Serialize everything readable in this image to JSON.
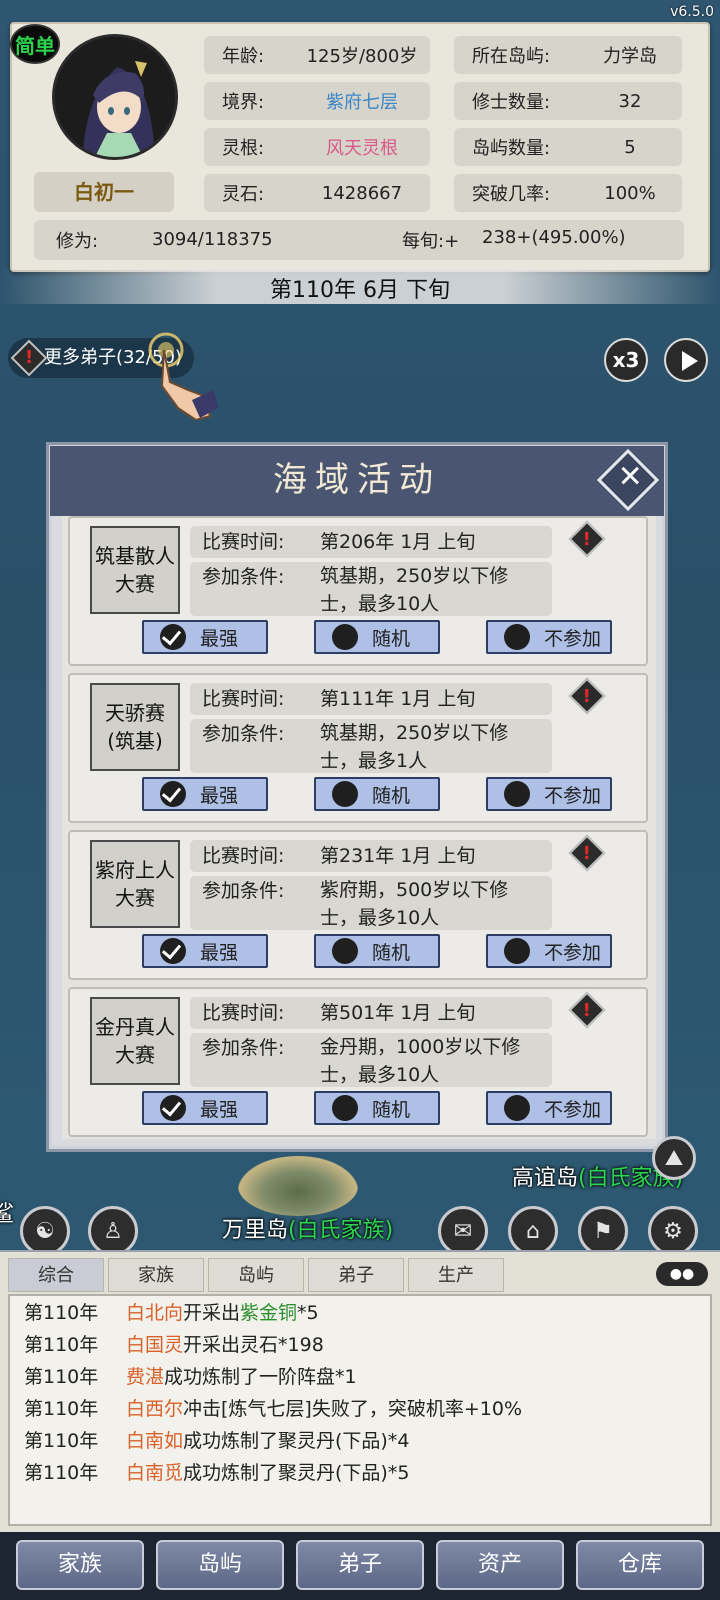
{
  "version": "v6.5.0",
  "difficulty": "简单",
  "player": {
    "name": "白初一",
    "stats_left": [
      {
        "key": "年龄:",
        "value": "125岁/800岁",
        "color": "#222222"
      },
      {
        "key": "境界:",
        "value": "紫府七层",
        "color": "#3a86c8"
      },
      {
        "key": "灵根:",
        "value": "风天灵根",
        "color": "#d95a8a"
      },
      {
        "key": "灵石:",
        "value": "1428667",
        "color": "#222222"
      }
    ],
    "stats_right": [
      {
        "key": "所在岛屿:",
        "value": "力学岛"
      },
      {
        "key": "修士数量:",
        "value": "32"
      },
      {
        "key": "岛屿数量:",
        "value": "5"
      },
      {
        "key": "突破几率:",
        "value": "100%"
      }
    ],
    "xiuwei_label": "修为:",
    "xiuwei_value": "3094/118375",
    "per_period_label": "每旬:+",
    "per_period_value": "238+(495.00%)"
  },
  "date": "第110年 6月 下旬",
  "more_disciples": "更多弟子(32/50)",
  "speed_label": "x3",
  "dialog": {
    "title": "海域活动",
    "time_label": "比赛时间:",
    "cond_label": "参加条件:",
    "options": [
      "最强",
      "随机",
      "不参加"
    ],
    "events": [
      {
        "name": "筑基散人\n大赛",
        "time": "第206年 1月 上旬",
        "cond": "筑基期，250岁以下修士，最多10人"
      },
      {
        "name": "天骄赛\n(筑基)",
        "time": "第111年 1月 上旬",
        "cond": "筑基期，250岁以下修士，最多1人"
      },
      {
        "name": "紫府上人\n大赛",
        "time": "第231年 1月 上旬",
        "cond": "紫府期，500岁以下修士，最多10人"
      },
      {
        "name": "金丹真人\n大赛",
        "time": "第501年 1月 上旬",
        "cond": "金丹期，1000岁以下修士，最多10人"
      }
    ]
  },
  "map": {
    "island_main": "万里岛",
    "island_main_family": "(白氏家族)",
    "island_right": "高谊岛",
    "island_right_family": "(白氏家族)",
    "left_edge_text": "鲨"
  },
  "log_tabs": [
    "综合",
    "家族",
    "岛屿",
    "弟子",
    "生产"
  ],
  "logs": [
    {
      "year": "第110年",
      "who": "白北向",
      "pre": "开采出",
      "item": "紫金铜",
      "post": "*5"
    },
    {
      "year": "第110年",
      "who": "白国灵",
      "pre": "开采出灵石*198",
      "item": "",
      "post": ""
    },
    {
      "year": "第110年",
      "who": "费湛",
      "pre": "成功炼制了一阶阵盘*1",
      "item": "",
      "post": ""
    },
    {
      "year": "第110年",
      "who": "白西尔",
      "pre": "冲击[炼气七层]失败了，突破机率+10%",
      "item": "",
      "post": ""
    },
    {
      "year": "第110年",
      "who": "白南如",
      "pre": "成功炼制了聚灵丹(下品)*4",
      "item": "",
      "post": ""
    },
    {
      "year": "第110年",
      "who": "白南觅",
      "pre": "成功炼制了聚灵丹(下品)*5",
      "item": "",
      "post": ""
    }
  ],
  "nav": [
    "家族",
    "岛屿",
    "弟子",
    "资产",
    "仓库"
  ]
}
